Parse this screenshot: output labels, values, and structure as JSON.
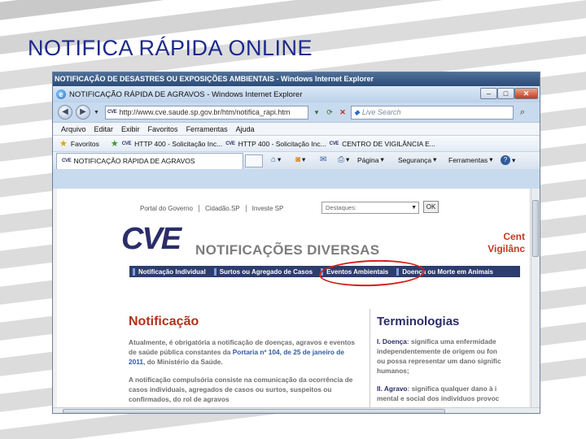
{
  "slide_title": "NOTIFICA RÁPIDA ONLINE",
  "outer_window_title": "NOTIFICAÇÃO DE DESASTRES OU EXPOSIÇÕES AMBIENTAIS - Windows Internet Explorer",
  "ie": {
    "title": "NOTIFICAÇÃO RÁPIDA DE AGRAVOS - Windows Internet Explorer",
    "url": "http://www.cve.saude.sp.gov.br/htm/notifica_rapi.htm",
    "search_placeholder": "Live Search",
    "menu": [
      "Arquivo",
      "Editar",
      "Exibir",
      "Favoritos",
      "Ferramentas",
      "Ajuda"
    ],
    "favorites_label": "Favoritos",
    "favorites": [
      "HTTP 400 - Solicitação Inc...",
      "HTTP 400 - Solicitação Inc...",
      "CENTRO DE VIGILÂNCIA E..."
    ],
    "tab_title": "NOTIFICAÇÃO RÁPIDA DE AGRAVOS",
    "commands": {
      "page": "Página",
      "security": "Segurança",
      "tools": "Ferramentas"
    }
  },
  "page": {
    "top_links": [
      "Portal do Governo",
      "Cidadão.SP",
      "Investe SP"
    ],
    "destaques_label": "Destaques:",
    "ok_label": "OK",
    "logo": "CVE",
    "heading": "NOTIFICAÇÕES DIVERSAS",
    "brand_right_1": "Cent",
    "brand_right_2": "Vigilânc",
    "nav": [
      "Notificação Individual",
      "Surtos ou Agregado de Casos",
      "Eventos Ambientais",
      "Doença ou Morte em Animais"
    ],
    "notificacao": {
      "title": "Notificação",
      "p1_a": "Atualmente, é obrigatória a notificação de doenças, agravos e eventos de saúde pública constantes da ",
      "p1_link": "Portaria nº 104, de 25 de janeiro de 2011",
      "p1_b": ", do Ministério da Saúde.",
      "p2": "A notificação compulsória consiste na comunicação da ocorrência de casos individuais, agregados de casos ou surtos, suspeitos ou confirmados, do rol de agravos"
    },
    "terminologias": {
      "title": "Terminologias",
      "t1_label": "I. Doença",
      "t1_lines": [
        ": significa uma enfermidade",
        "independentemente de origem ou fon",
        "ou possa representar um dano signific",
        "humanos;"
      ],
      "t2_label": "II. Agravo",
      "t2_lines": [
        ": significa qualquer dano à i",
        "mental e social dos indivíduos provoc"
      ]
    }
  }
}
